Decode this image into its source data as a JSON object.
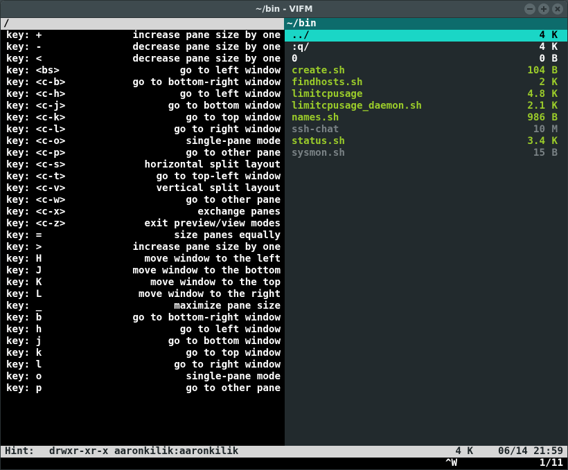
{
  "window": {
    "title": "~/bin - VIFM"
  },
  "tabs": {
    "left": "/",
    "right": "~/bin"
  },
  "keys": [
    {
      "key": "+",
      "desc": "increase pane size by one"
    },
    {
      "key": "-",
      "desc": "decrease pane size by one"
    },
    {
      "key": "<",
      "desc": "decrease pane size by one"
    },
    {
      "key": "<bs>",
      "desc": "go to left window"
    },
    {
      "key": "<c-b>",
      "desc": "go to bottom-right window"
    },
    {
      "key": "<c-h>",
      "desc": "go to left window"
    },
    {
      "key": "<c-j>",
      "desc": "go to bottom window"
    },
    {
      "key": "<c-k>",
      "desc": "go to top window"
    },
    {
      "key": "<c-l>",
      "desc": "go to right window"
    },
    {
      "key": "<c-o>",
      "desc": "single-pane mode"
    },
    {
      "key": "<c-p>",
      "desc": "go to other pane"
    },
    {
      "key": "<c-s>",
      "desc": "horizontal split layout"
    },
    {
      "key": "<c-t>",
      "desc": "go to top-left window"
    },
    {
      "key": "<c-v>",
      "desc": "vertical split layout"
    },
    {
      "key": "<c-w>",
      "desc": "go to other pane"
    },
    {
      "key": "<c-x>",
      "desc": "exchange panes"
    },
    {
      "key": "<c-z>",
      "desc": "exit preview/view modes"
    },
    {
      "key": "=",
      "desc": "size panes equally"
    },
    {
      "key": ">",
      "desc": "increase pane size by one"
    },
    {
      "key": "H",
      "desc": "move window to the left"
    },
    {
      "key": "J",
      "desc": "move window to the bottom"
    },
    {
      "key": "K",
      "desc": "move window to the top"
    },
    {
      "key": "L",
      "desc": "move window to the right"
    },
    {
      "key": "_",
      "desc": "maximize pane size"
    },
    {
      "key": "b",
      "desc": "go to bottom-right window"
    },
    {
      "key": "h",
      "desc": "go to left window"
    },
    {
      "key": "j",
      "desc": "go to bottom window"
    },
    {
      "key": "k",
      "desc": "go to top window"
    },
    {
      "key": "l",
      "desc": "go to right window"
    },
    {
      "key": "o",
      "desc": "single-pane mode"
    },
    {
      "key": "p",
      "desc": "go to other pane"
    }
  ],
  "files": [
    {
      "name": "../",
      "size": "4",
      "unit": "K",
      "cls": "sel",
      "sel": true
    },
    {
      "name": ":q/",
      "size": "4",
      "unit": "K",
      "cls": "dir"
    },
    {
      "name": "0",
      "size": "0",
      "unit": "B",
      "cls": "dir"
    },
    {
      "name": "create.sh",
      "size": "104",
      "unit": "B",
      "cls": "exe"
    },
    {
      "name": "findhosts.sh",
      "size": "2",
      "unit": "K",
      "cls": "exe"
    },
    {
      "name": "limitcpusage",
      "size": "4.8",
      "unit": "K",
      "cls": "exe"
    },
    {
      "name": "limitcpusage_daemon.sh",
      "size": "2.1",
      "unit": "K",
      "cls": "exe"
    },
    {
      "name": "names.sh",
      "size": "986",
      "unit": "B",
      "cls": "exe"
    },
    {
      "name": "ssh-chat",
      "size": "10",
      "unit": "M",
      "cls": "plain"
    },
    {
      "name": "status.sh",
      "size": "3.4",
      "unit": "K",
      "cls": "exe"
    },
    {
      "name": "sysmon.sh",
      "size": "15",
      "unit": "B",
      "cls": "plain"
    }
  ],
  "status": {
    "hint": "Hint:",
    "perm": "drwxr-xr-x aaronkilik:aaronkilik",
    "size": "4 K",
    "date": "06/14 21:59"
  },
  "cmd": {
    "mode": "^W",
    "pos": "1/11"
  }
}
